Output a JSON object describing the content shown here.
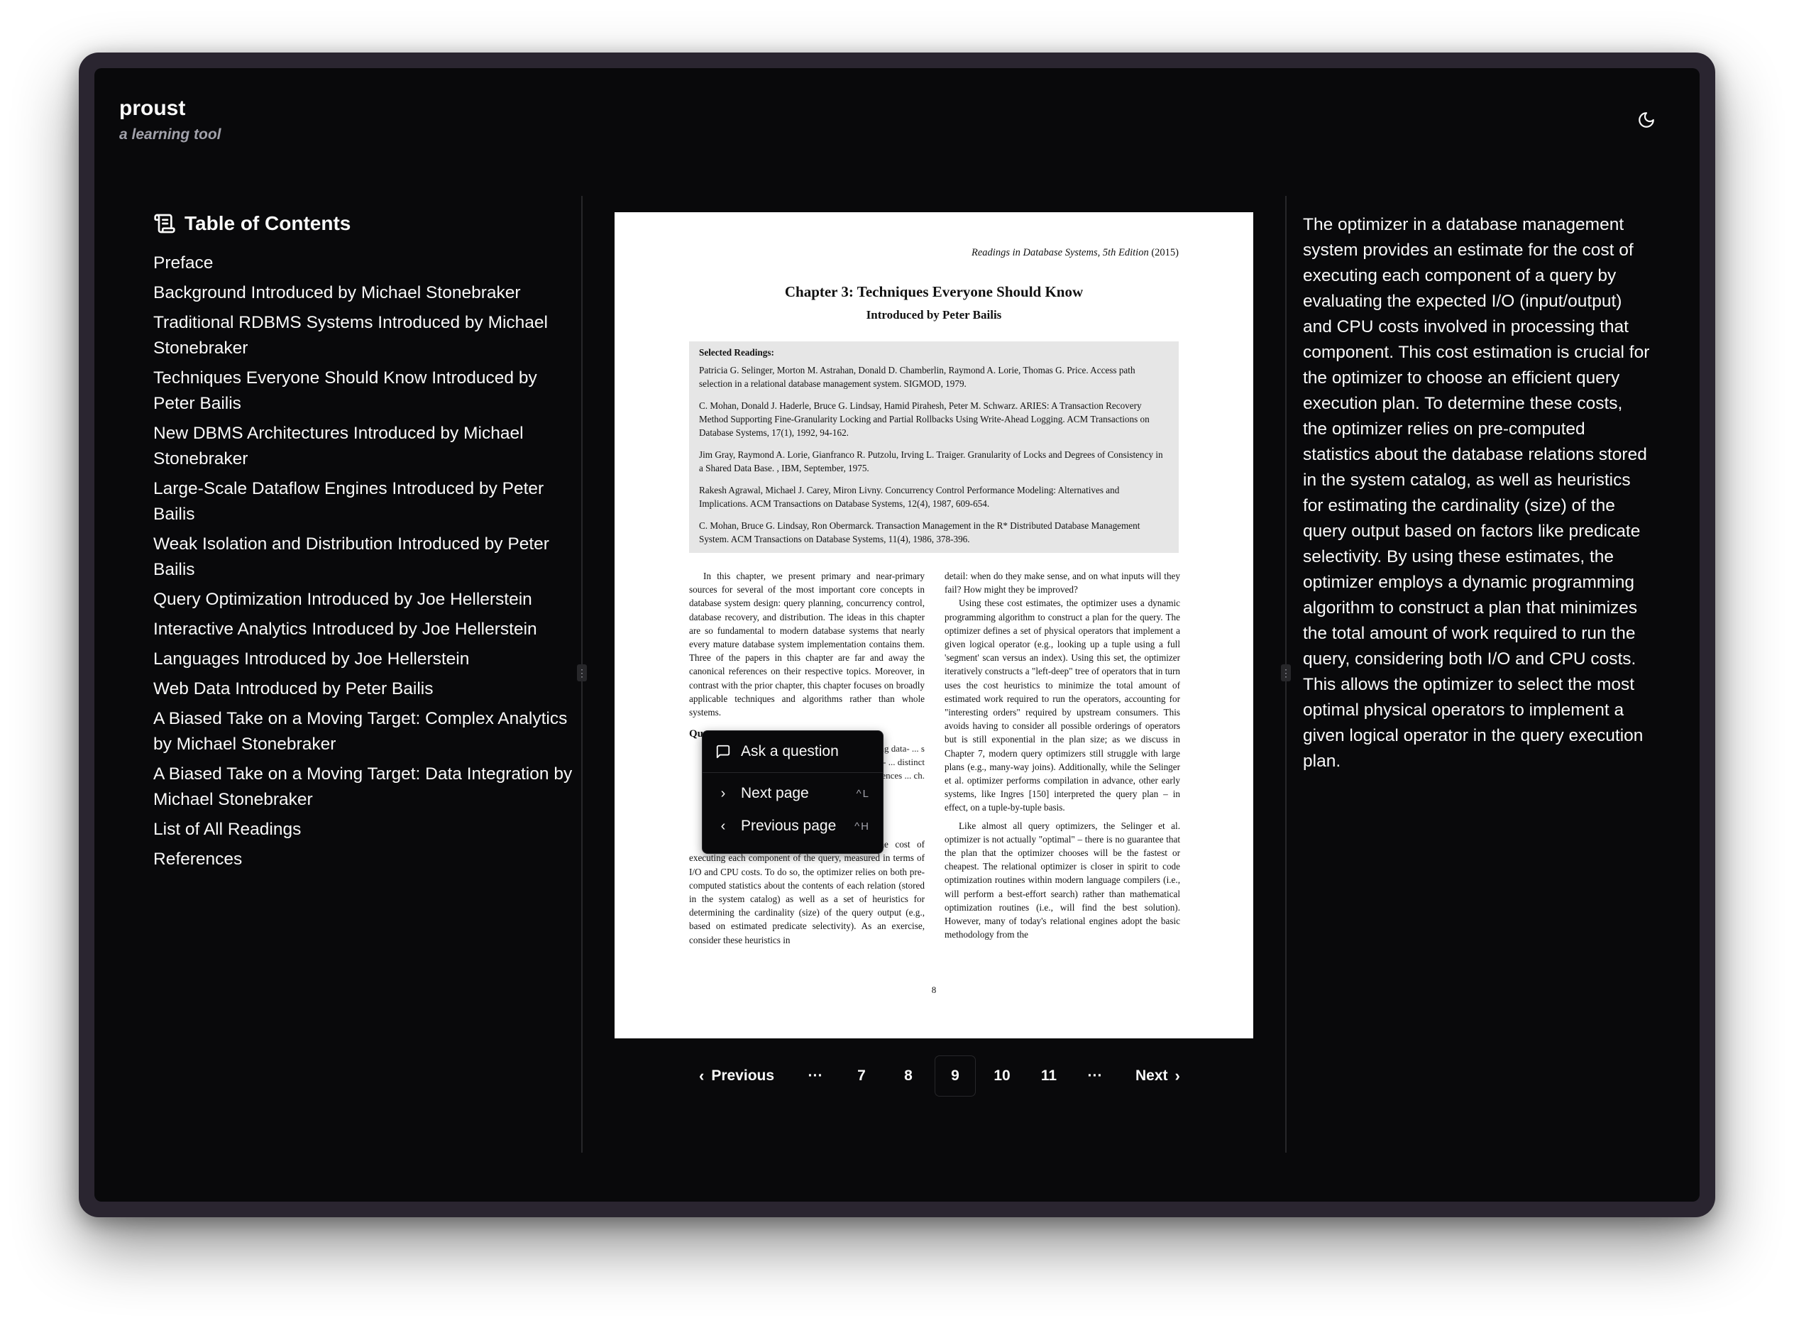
{
  "app": {
    "name": "proust",
    "tagline": "a learning tool"
  },
  "toc": {
    "title": "Table of Contents",
    "items": [
      "Preface",
      "Background Introduced by Michael Stonebraker",
      "Traditional RDBMS Systems Introduced by Michael Stonebraker",
      "Techniques Everyone Should Know Introduced by Peter Bailis",
      "New DBMS Architectures Introduced by Michael Stonebraker",
      "Large-Scale Dataflow Engines Introduced by Peter Bailis",
      "Weak Isolation and Distribution Introduced by Peter Bailis",
      "Query Optimization Introduced by Joe Hellerstein",
      "Interactive Analytics Introduced by Joe Hellerstein",
      "Languages Introduced by Joe Hellerstein",
      "Web Data Introduced by Peter Bailis",
      "A Biased Take on a Moving Target: Complex Analytics by Michael Stonebraker",
      "A Biased Take on a Moving Target: Data Integration by Michael Stonebraker",
      "List of All Readings",
      "References"
    ]
  },
  "pdf": {
    "header_italic": "Readings in Database Systems, 5th Edition",
    "header_year": " (2015)",
    "title": "Chapter 3: Techniques Everyone Should Know",
    "subtitle": "Introduced by Peter Bailis",
    "readings_title": "Selected Readings:",
    "readings": [
      "Patricia G. Selinger, Morton M. Astrahan, Donald D. Chamberlin, Raymond A. Lorie, Thomas G. Price. Access path selection in a relational database management system. SIGMOD, 1979.",
      "C. Mohan, Donald J. Haderle, Bruce G. Lindsay, Hamid Pirahesh, Peter M. Schwarz. ARIES: A Transaction Recovery Method Supporting Fine-Granularity Locking and Partial Rollbacks Using Write-Ahead Logging. ACM Transactions on Database Systems, 17(1), 1992, 94-162.",
      "Jim Gray, Raymond A. Lorie, Gianfranco R. Putzolu, Irving L. Traiger. Granularity of Locks and Degrees of Consistency in a Shared Data Base. , IBM, September, 1975.",
      "Rakesh Agrawal, Michael J. Carey, Miron Livny. Concurrency Control Performance Modeling: Alternatives and Implications. ACM Transactions on Database Systems, 12(4), 1987, 609-654.",
      "C. Mohan, Bruce G. Lindsay, Ron Obermarck. Transaction Management in the R* Distributed Database Management System. ACM Transactions on Database Systems, 11(4), 1986, 378-396."
    ],
    "left_col_p1": "In this chapter, we present primary and near-primary sources for several of the most important core concepts in database system design: query planning, concurrency control, database recovery, and distribution. The ideas in this chapter are so fundamental to modern database systems that nearly every mature database system implementation contains them. Three of the papers in this chapter are far and away the canonical references on their respective topics. Moreover, in contrast with the prior chapter, this chapter focuses on broadly applicable techniques and algorithms rather than whole systems.",
    "left_col_heading": "Qu",
    "left_col_p2_fragment": "relational ... ing data- ... s founda- ... ery opti- ... distinct ... ivalences ... ch.",
    "left_col_p3": "The optimizer provides an estimate for the cost of executing each component of the query, measured in terms of I/O and CPU costs. To do so, the optimizer relies on both pre-computed statistics about the contents of each relation (stored in the system catalog) as well as a set of heuristics for determining the cardinality (size) of the query output (e.g., based on estimated predicate selectivity). As an exercise, consider these heuristics in",
    "right_col_p1": "detail: when do they make sense, and on what inputs will they fail? How might they be improved?",
    "right_col_p2": "Using these cost estimates, the optimizer uses a dynamic programming algorithm to construct a plan for the query. The optimizer defines a set of physical operators that implement a given logical operator (e.g., looking up a tuple using a full 'segment' scan versus an index). Using this set, the optimizer iteratively constructs a \"left-deep\" tree of operators that in turn uses the cost heuristics to minimize the total amount of estimated work required to run the operators, accounting for \"interesting orders\" required by upstream consumers. This avoids having to consider all possible orderings of operators but is still exponential in the plan size; as we discuss in Chapter 7, modern query optimizers still struggle with large plans (e.g., many-way joins). Additionally, while the Selinger et al. optimizer performs compilation in advance, other early systems, like Ingres [150] interpreted the query plan – in effect, on a tuple-by-tuple basis.",
    "right_col_p3": "Like almost all query optimizers, the Selinger et al. optimizer is not actually \"optimal\" – there is no guarantee that the plan that the optimizer chooses will be the fastest or cheapest. The relational optimizer is closer in spirit to code optimization routines within modern language compilers (i.e., will perform a best-effort search) rather than mathematical optimization routines (i.e., will find the best solution). However, many of today's relational engines adopt the basic methodology from the",
    "page_number": "8"
  },
  "context_menu": {
    "ask": "Ask a question",
    "next": "Next page",
    "next_kbd": "^L",
    "prev": "Previous page",
    "prev_kbd": "^H"
  },
  "pagination": {
    "previous": "Previous",
    "next": "Next",
    "ellipsis": "···",
    "pages": [
      "7",
      "8",
      "9",
      "10",
      "11"
    ],
    "current": "9"
  },
  "explanation": "The optimizer in a database management system provides an estimate for the cost of executing each component of a query by evaluating the expected I/O (input/output) and CPU costs involved in processing that component. This cost estimation is crucial for the optimizer to choose an efficient query execution plan. To determine these costs, the optimizer relies on pre-computed statistics about the database relations stored in the system catalog, as well as heuristics for estimating the cardinality (size) of the query output based on factors like predicate selectivity. By using these estimates, the optimizer employs a dynamic programming algorithm to construct a plan that minimizes the total amount of work required to run the query, considering both I/O and CPU costs. This allows the optimizer to select the most optimal physical operators to implement a given logical operator in the query execution plan.",
  "icons": {
    "theme": "moon-icon",
    "toc": "scroll-icon",
    "ask": "message-square-icon",
    "next": "chevron-right-icon",
    "prev": "chevron-left-icon",
    "grip": "grip-vertical-icon"
  },
  "colors": {
    "background": "#09090b",
    "foreground": "#fafafa",
    "muted": "#a1a1aa",
    "border": "#27272a"
  }
}
